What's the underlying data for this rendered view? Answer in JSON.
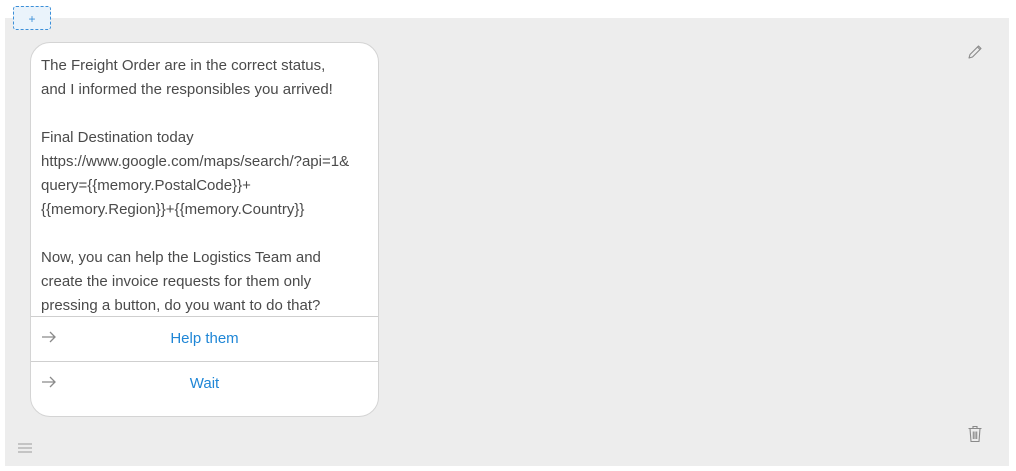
{
  "add_button": {
    "label": "+"
  },
  "message": {
    "paragraphs": [
      "The Freight Order are in the correct status,\nand I informed the responsibles you arrived!",
      "Final Destination today\nhttps://www.google.com/maps/search/?api=1&\nquery={{memory.PostalCode}}+\n{{memory.Region}}+{{memory.Country}}",
      "Now, you can help the Logistics Team and\ncreate the invoice requests for them only\npressing a button, do you want to do that?"
    ]
  },
  "quick_replies": [
    {
      "label": "Help them",
      "icon": "arrow-right-icon"
    },
    {
      "label": "Wait",
      "icon": "arrow-right-icon"
    }
  ],
  "icons": {
    "edit": "pencil-icon",
    "delete": "trash-icon",
    "drag": "drag-handle-icon"
  },
  "colors": {
    "panel_bg": "#ededed",
    "accent": "#1f86d6",
    "text": "#4a4a4a"
  }
}
